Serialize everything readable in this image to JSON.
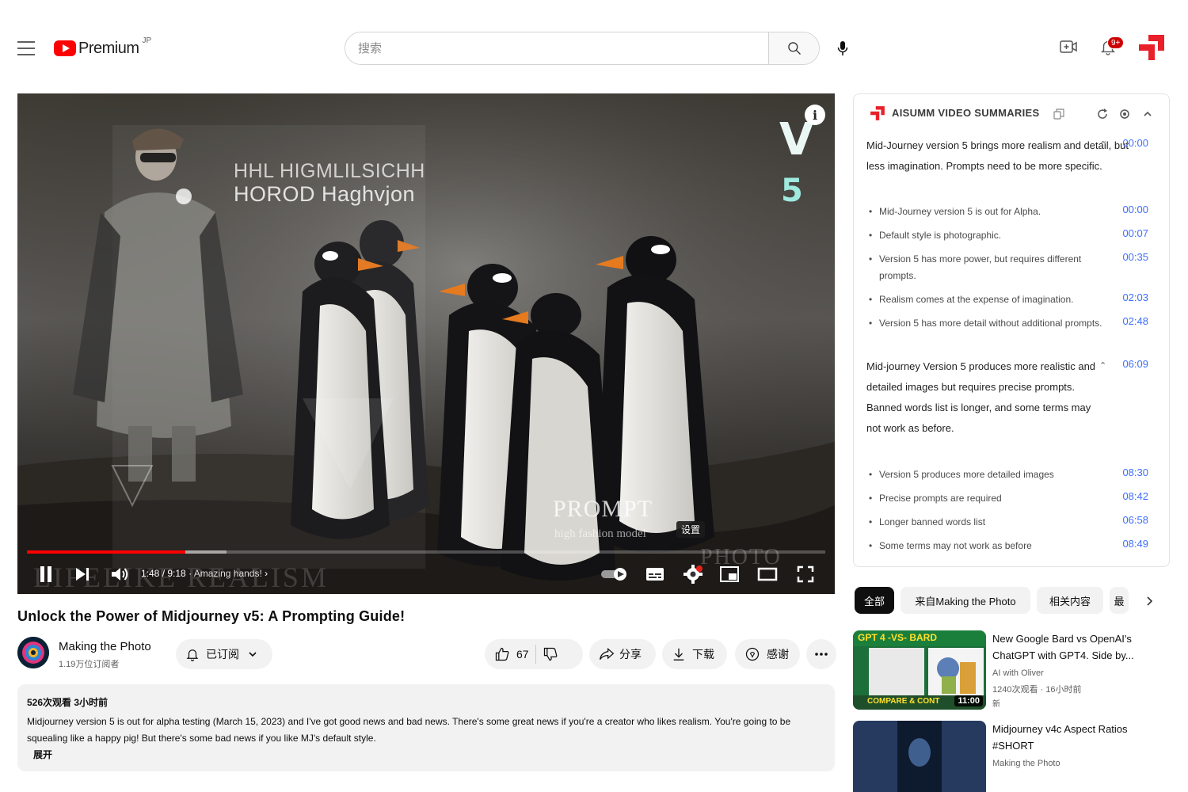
{
  "header": {
    "logo_text": "Premium",
    "region": "JP",
    "search_placeholder": "搜索",
    "notification_count": "9+"
  },
  "player": {
    "overlay_line1": "HHL HIGMLILSICHH",
    "overlay_line2": "HOROD Haghvjon",
    "version_letter": "V",
    "version_number": "5",
    "prompt_title": "PROMPT",
    "prompt_subtitle": "high fashion model",
    "settings_tooltip": "设置",
    "watermark_left": "LIFELIKE REALISM",
    "watermark_right": "PHOTO",
    "time_current": "1:48",
    "time_total": "9:18",
    "chapter": "Amazing hands!",
    "progress_played_fraction": 0.198,
    "progress_buffered_fraction": 0.25
  },
  "video": {
    "title": "Unlock the Power of Midjourney v5: A Prompting Guide!",
    "channel_name": "Making the Photo",
    "subscribers": "1.19万位订阅者",
    "subscribed_label": "已订阅",
    "like_count": "67",
    "share_label": "分享",
    "download_label": "下载",
    "thanks_label": "感谢",
    "views_time": "526次观看  3小时前",
    "description": "Midjourney version 5 is out for alpha testing (March 15, 2023) and I've got good news and bad news. There's some great news if you're a creator who likes realism. You're going to be squealing like a happy pig! But there's some bad news if you like MJ's default style.",
    "expand_label": "展开"
  },
  "summary": {
    "title": "AISUMM VIDEO SUMMARIES",
    "sections": [
      {
        "text": "Mid-Journey version 5 brings more realism and detail, but less imagination. Prompts need to be more specific.",
        "time": "00:00",
        "points": [
          {
            "text": "Mid-Journey version 5 is out for Alpha.",
            "time": "00:00"
          },
          {
            "text": "Default style is photographic.",
            "time": "00:07"
          },
          {
            "text": "Version 5 has more power, but requires different prompts.",
            "time": "00:35"
          },
          {
            "text": "Realism comes at the expense of imagination.",
            "time": "02:03"
          },
          {
            "text": "Version 5 has more detail without additional prompts.",
            "time": "02:48"
          }
        ]
      },
      {
        "text": "Mid-journey Version 5 produces more realistic and detailed images but requires precise prompts. Banned words list is longer, and some terms may not work as before.",
        "time": "06:09",
        "points": [
          {
            "text": "Version 5 produces more detailed images",
            "time": "08:30"
          },
          {
            "text": "Precise prompts are required",
            "time": "08:42"
          },
          {
            "text": "Longer banned words list",
            "time": "06:58"
          },
          {
            "text": "Some terms may not work as before",
            "time": "08:49"
          }
        ]
      }
    ]
  },
  "chips": [
    "全部",
    "来自Making the Photo",
    "相关内容",
    "最"
  ],
  "recommendations": [
    {
      "thumb_top": "GPT 4 -VS- BARD",
      "thumb_bottom": "COMPARE & CONT",
      "duration": "11:00",
      "title": "New Google Bard vs OpenAI's ChatGPT with GPT4. Side by...",
      "channel": "AI with Oliver",
      "meta": "1240次观看 · 16小时前",
      "badge": "新"
    },
    {
      "title": "Midjourney v4c Aspect Ratios #SHORT",
      "channel": "Making the Photo"
    }
  ]
}
